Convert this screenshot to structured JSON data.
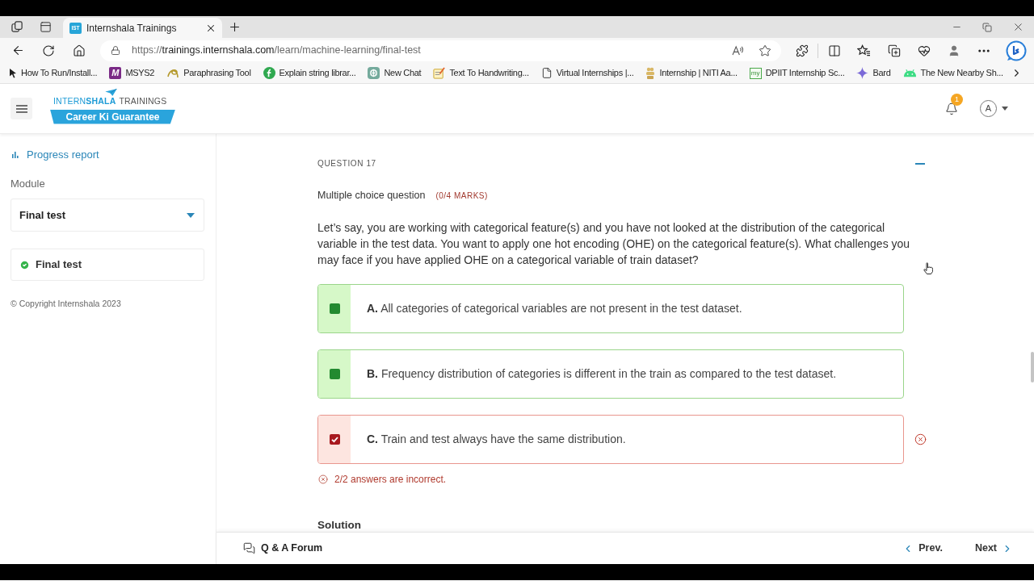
{
  "browser": {
    "tabs": [
      {
        "icon_text": "IST",
        "title": "Internshala Trainings",
        "selected": true
      }
    ],
    "url": {
      "scheme": "https://",
      "host": "trainings.internshala.com",
      "path": "/learn/machine-learning/final-test"
    },
    "bookmarks": [
      {
        "kind": "cursor",
        "label": "How To Run/Install..."
      },
      {
        "kind": "monogram",
        "icon_text": "M",
        "label": "MSYS2"
      },
      {
        "kind": "squiggle",
        "label": "Paraphrasing Tool"
      },
      {
        "kind": "leaf",
        "label": "Explain string librar..."
      },
      {
        "kind": "knot",
        "label": "New Chat"
      },
      {
        "kind": "notepad",
        "label": "Text To Handwriting..."
      },
      {
        "kind": "page",
        "label": "Virtual Internships |..."
      },
      {
        "kind": "emblem",
        "label": "Internship | NITI Aa..."
      },
      {
        "kind": "stamp",
        "icon_text": "my",
        "label": "DPIIT Internship Sc..."
      },
      {
        "kind": "sparkle",
        "label": "Bard"
      },
      {
        "kind": "android",
        "label": "The New Nearby Sh..."
      }
    ]
  },
  "header": {
    "logo": {
      "name": "INTERN**SHALA**",
      "subtitle": "TRAININGS",
      "tagline": "Career Ki Guarantee"
    },
    "notification_count": "1",
    "avatar": "A"
  },
  "sidebar": {
    "progress_link": "Progress report",
    "module_label": "Module",
    "module_select": {
      "value": "Final test"
    },
    "items": [
      {
        "label": "Final test",
        "completed": true
      }
    ],
    "copyright": "© Copyright Internshala 2023"
  },
  "question": {
    "number_label": "QUESTION 17",
    "expanded": true,
    "type": "Multiple choice question",
    "marks": "(0/4 MARKS)",
    "text": "Let’s say, you are working with categorical feature(s) and you have not looked at the distribution of the categorical variable in the test data. You want to apply one hot encoding (OHE) on the categorical feature(s). What challenges you may face if you have applied OHE on a categorical variable of train dataset?",
    "options": [
      {
        "letter": "A.",
        "text": "All categories of categorical variables are not present in the test dataset.",
        "correct": true,
        "checked": false
      },
      {
        "letter": "B.",
        "text": "Frequency distribution of categories is different in the train as compared to the test dataset.",
        "correct": true,
        "checked": false
      },
      {
        "letter": "C.",
        "text": "Train and test always have the same distribution.",
        "correct": false,
        "checked": true
      }
    ],
    "feedback": "2/2 answers are incorrect.",
    "solution_heading": "Solution"
  },
  "footer": {
    "forum": "Q & A Forum",
    "prev": "Prev.",
    "next": "Next"
  }
}
